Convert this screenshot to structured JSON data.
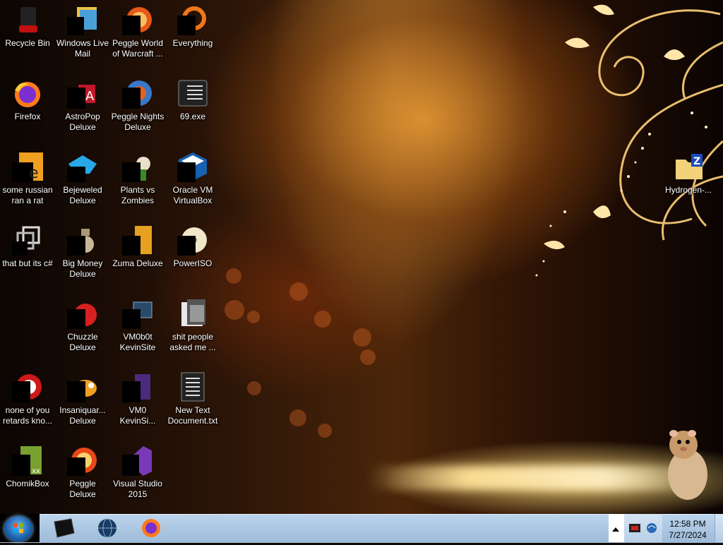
{
  "desktop": {
    "icons": [
      {
        "label": "Recycle Bin"
      },
      {
        "label": "Windows Live Mail"
      },
      {
        "label": "Peggle World of Warcraft ..."
      },
      {
        "label": "Everything"
      },
      {
        "label": "Firefox"
      },
      {
        "label": "AstroPop Deluxe"
      },
      {
        "label": "Peggle Nights Deluxe"
      },
      {
        "label": "69.exe"
      },
      {
        "label": "some russian ran a rat"
      },
      {
        "label": "Bejeweled Deluxe"
      },
      {
        "label": "Plants vs Zombies"
      },
      {
        "label": "Oracle VM VirtualBox"
      },
      {
        "label": "that but its c#"
      },
      {
        "label": "Big Money Deluxe"
      },
      {
        "label": "Zuma Deluxe"
      },
      {
        "label": "PowerISO"
      },
      {
        "label": "Chuzzle Deluxe"
      },
      {
        "label": "VM0b0t KevinSite"
      },
      {
        "label": "shit people asked me ..."
      },
      {
        "label": "none of you retards kno..."
      },
      {
        "label": "Insaniquar... Deluxe"
      },
      {
        "label": "VM0 KevinSi..."
      },
      {
        "label": "New Text Document.txt"
      },
      {
        "label": "ChomikBox"
      },
      {
        "label": "Peggle Deluxe"
      },
      {
        "label": "Visual Studio 2015"
      },
      {
        "label": "Hydrogen-..."
      }
    ]
  },
  "taskbar": {
    "pinned": [
      {
        "icon": "terminal-icon"
      },
      {
        "icon": "globe-icon"
      },
      {
        "icon": "firefox-icon"
      }
    ],
    "clock": {
      "time": "12:58 PM",
      "date": "7/27/2024"
    }
  },
  "colors": {
    "taskbar": "#a9c4e0",
    "accent": "#f0a830"
  }
}
